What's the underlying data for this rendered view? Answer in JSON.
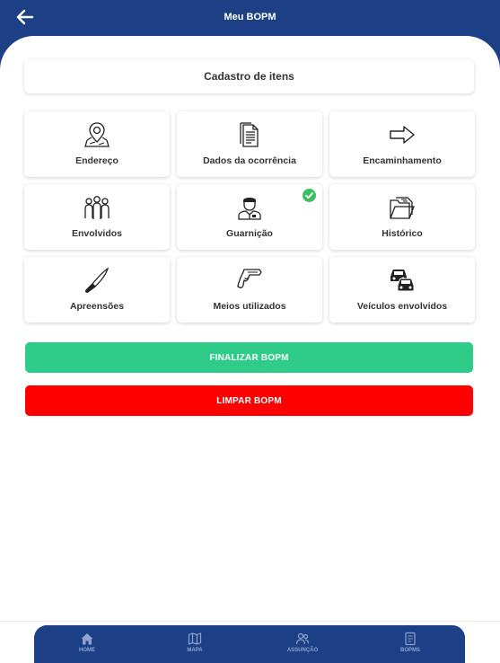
{
  "header": {
    "title": "Meu BOPM",
    "back_icon": "arrow-left-icon"
  },
  "title_card": {
    "label": "Cadastro de itens"
  },
  "tiles": [
    {
      "label": "Endereço",
      "icon": "map-pin-icon"
    },
    {
      "label": "Dados da ocorrência",
      "icon": "document-icon"
    },
    {
      "label": "Encaminhamento",
      "icon": "arrow-right-icon"
    },
    {
      "label": "Envolvidos",
      "icon": "people-group-icon"
    },
    {
      "label": "Guarnição",
      "icon": "police-officer-icon",
      "completed": true
    },
    {
      "label": "Histórico",
      "icon": "folder-icon"
    },
    {
      "label": "Apreensões",
      "icon": "knife-icon"
    },
    {
      "label": "Meios utilizados",
      "icon": "gun-icon"
    },
    {
      "label": "Veículos envolvidos",
      "icon": "cars-icon"
    }
  ],
  "actions": {
    "finalizar": "FINALIZAR BOPM",
    "limpar": "LIMPAR BOPM"
  },
  "bottom_nav": [
    {
      "label": "HOME",
      "icon": "home-icon"
    },
    {
      "label": "MAPA",
      "icon": "map-icon"
    },
    {
      "label": "ASSUNÇÃO",
      "icon": "users-icon"
    },
    {
      "label": "BOPMS",
      "icon": "notebook-icon"
    }
  ],
  "colors": {
    "primary": "#1c3f86",
    "success": "#2ecc88",
    "danger": "#ff0000",
    "check": "#3cbf63"
  }
}
